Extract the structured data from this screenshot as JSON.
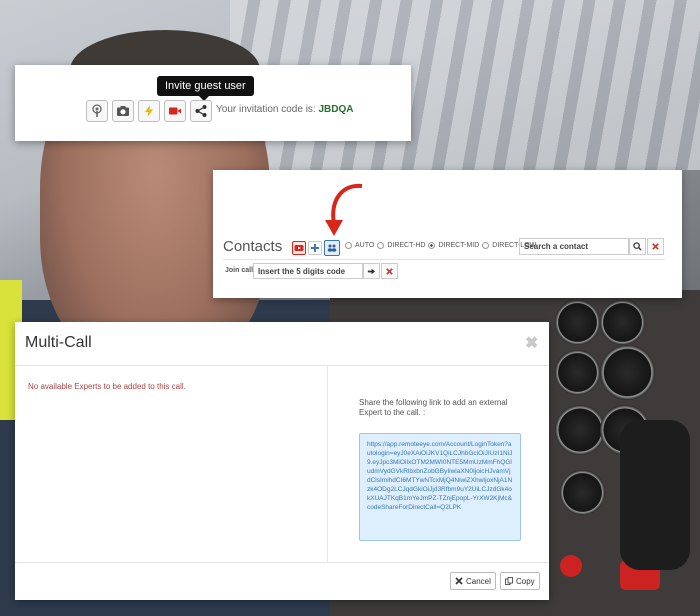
{
  "toolbar": {
    "tooltip": "Invite guest user",
    "invitation_prefix": "Your invitation code is:",
    "invitation_code": "JBDQA",
    "buttons": [
      "podcast-icon",
      "camera-icon",
      "flash-icon",
      "video-icon",
      "share-icon"
    ]
  },
  "contacts": {
    "title": "Contacts",
    "quality_options": [
      "AUTO",
      "DIRECT-HD",
      "DIRECT-MID",
      "DIRECT-LOW"
    ],
    "selected_quality": "DIRECT-MID",
    "search_placeholder": "Search a contact",
    "join_label": "Join call",
    "join_placeholder": "Insert the 5 digits code"
  },
  "dialog": {
    "title": "Multi-Call",
    "no_experts": "No available Experts to be added to this call.",
    "share_text": "Share the following link to add an external Expert to the call. :",
    "link": "https://app.remoteeye.com/Account/LoginToken?autologin=eyJ0eXAiOiJKV1QiLCJhbGciOiJIUzI1NiJ9.eyJpc3MiOiIxOTM2MWI0NTE5MmUzMmFhQGludmVydGVkRlbxbnZobGByIiwiaXN0IjoicHJvamVjdClsImlhdCI6MTYwNTcxMjQ4NiwiZXhwIjoxNjA1Nzk4ODg2LCJqdGkiOiJjd3Rfbm9uY2UiLCJzdGk4okXUAJTKqB1mYeJmPZ-TZnjEpopL-YrXW2KjMc&codeShareForDirectCall=Q2LPK",
    "cancel_label": "Cancel",
    "copy_label": "Copy"
  },
  "colors": {
    "accent_red": "#d9261c",
    "link_blue": "#3a78b5",
    "error_red": "#a94442",
    "code_green": "#2d6a2d"
  }
}
